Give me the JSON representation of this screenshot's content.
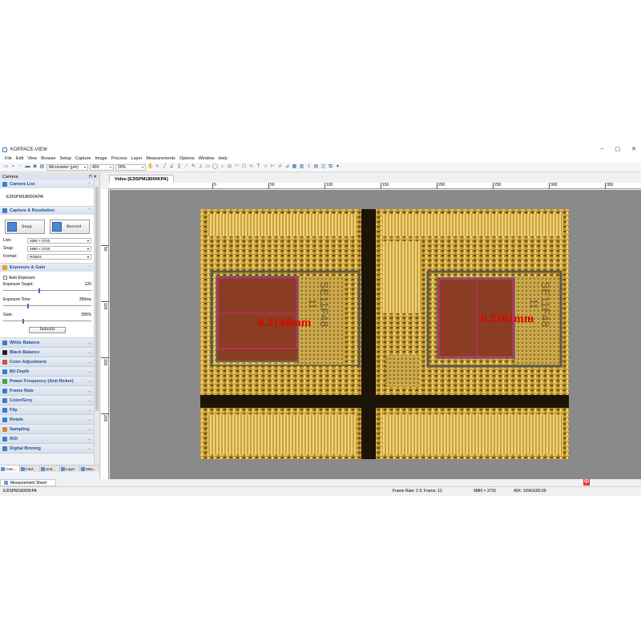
{
  "app": {
    "title": "KOPPACE-VIEW"
  },
  "window_controls": {
    "minimize": "–",
    "maximize": "▢",
    "close": "✕"
  },
  "menu": [
    "File",
    "Edit",
    "View",
    "Browse",
    "Setup",
    "Capture",
    "Image",
    "Process",
    "Layer",
    "Measurements",
    "Options",
    "Window",
    "Help"
  ],
  "toolbar": {
    "unit_select": "Micrometer (μm)",
    "magnification_select": "40X",
    "zoom_select": "20%"
  },
  "left_panel": {
    "title": "Camera",
    "pin": "⊓",
    "close": "✕",
    "camera_list": {
      "header": "Camera List",
      "item": "E3ISPM18000KPA"
    },
    "capture": {
      "header": "Capture & Resolution",
      "snap_label": "Snap",
      "record_label": "Record",
      "live_label": "Live:",
      "live_value": "4880 × 3720",
      "snap_field_label": "Snap:",
      "snap_value": "4880 × 3720",
      "format_label": "Format:",
      "format_value": "RGB24"
    },
    "exposure": {
      "header": "Exposure & Gain",
      "auto_label": "Auto Exposure",
      "target_label": "Exposure Target:",
      "target_value": "120",
      "target_level": 0.4,
      "time_label": "Exposure Time:",
      "time_value": "350ms",
      "time_level": 0.27,
      "gain_label": "Gain:",
      "gain_value": "395%",
      "gain_level": 0.22,
      "defaults_label": "Defaults"
    },
    "collapsed_sections": [
      {
        "label": "White Balance",
        "color": "#3d7bd0"
      },
      {
        "label": "Black Balance",
        "color": "#222222"
      },
      {
        "label": "Color Adjustment",
        "color": "#d24a3a"
      },
      {
        "label": "Bit Depth",
        "color": "#3d7bd0"
      },
      {
        "label": "Power Frequency (Anti-flicker)",
        "color": "#4aa04a"
      },
      {
        "label": "Frame Rate",
        "color": "#3d7bd0"
      },
      {
        "label": "Color/Grey",
        "color": "#3d7bd0"
      },
      {
        "label": "Flip",
        "color": "#3d7bd0"
      },
      {
        "label": "Rotate",
        "color": "#3d7bd0"
      },
      {
        "label": "Sampling",
        "color": "#d08a3a"
      },
      {
        "label": "ROI",
        "color": "#3d7bd0"
      },
      {
        "label": "Digital Binning",
        "color": "#3d7bd0"
      }
    ],
    "bottom_tabs": [
      "Cam...",
      "Fold...",
      "Und...",
      "Layer",
      "Mea..."
    ]
  },
  "video": {
    "tab_label": "Video [E3ISPM18000KPA]",
    "ruler_top": [
      "0",
      "50",
      "100",
      "150",
      "200",
      "250",
      "300",
      "350"
    ],
    "ruler_left": [
      "50",
      "100",
      "150",
      "200"
    ],
    "measurement_left": "0.2148mm",
    "measurement_right": "0.2161mm",
    "chip_marking_left_1": "SE11F48",
    "chip_marking_left_2": "11",
    "chip_marking_right_1": "SE11F48",
    "chip_marking_right_2": "11",
    "measure_color": "#e0208a",
    "label_color": "#e00000"
  },
  "bottom": {
    "measurement_sheet": "Measurement Sheet",
    "status_camera": "E3ISPM18000KPA",
    "status_framerate": "Frame Rate: 2.9; Frame: 13",
    "status_resolution": "4880 × 3720",
    "status_mag": "40X: 16941180.60",
    "tray_text": "中"
  }
}
